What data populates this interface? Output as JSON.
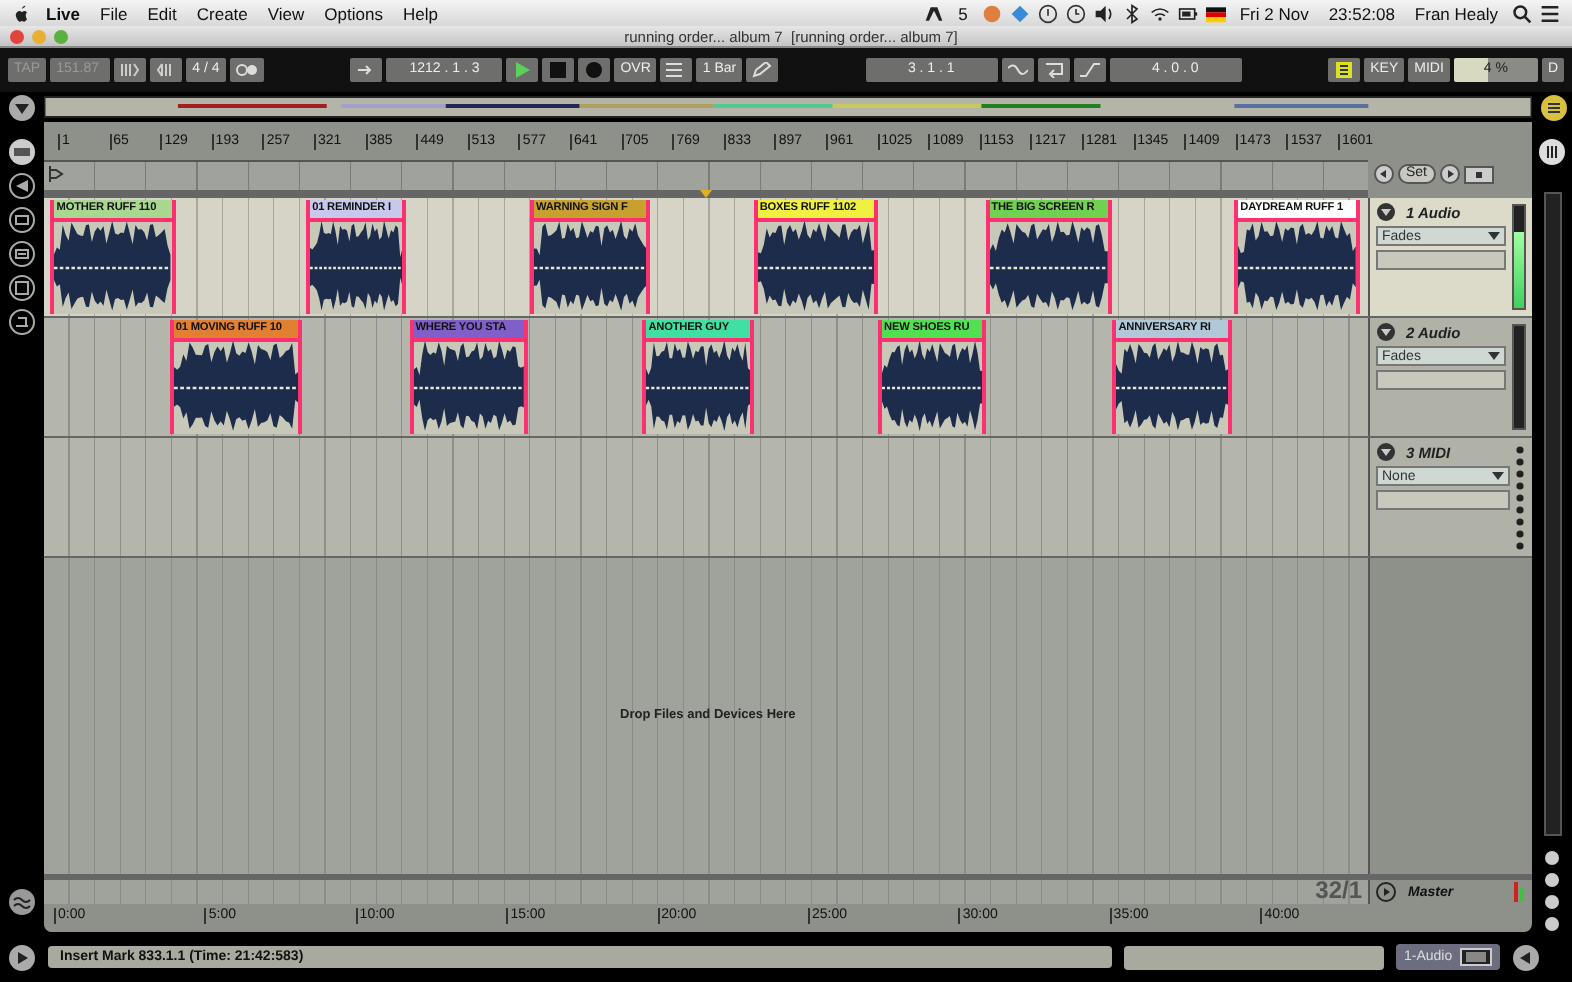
{
  "menu_bar": {
    "app": "Live",
    "items": [
      "File",
      "Edit",
      "Create",
      "View",
      "Options",
      "Help"
    ],
    "status_text": "5",
    "date": "Fri 2 Nov",
    "time": "23:52:08",
    "user": "Fran Healy"
  },
  "window": {
    "title": "running order... album 7  [running order... album 7]"
  },
  "control_bar": {
    "tap": "TAP",
    "tempo": "151.87",
    "signature": "4 / 4",
    "position": "1212 . 1 . 3",
    "ovr": "OVR",
    "quantize": "1 Bar",
    "loop_start": "3 . 1 . 1",
    "loop_length": "4 . 0 . 0",
    "key": "KEY",
    "midi": "MIDI",
    "cpu": "4 %",
    "d": "D"
  },
  "ruler": {
    "bars": [
      "1",
      "65",
      "129",
      "193",
      "257",
      "321",
      "385",
      "449",
      "513",
      "577",
      "641",
      "705",
      "769",
      "833",
      "897",
      "961",
      "1025",
      "1089",
      "1153",
      "1217",
      "1281",
      "1345",
      "1409",
      "1473",
      "1537",
      "1601"
    ]
  },
  "locators": {
    "set": "Set"
  },
  "tracks": [
    {
      "name": "1 Audio",
      "kind": "audio",
      "selected": true,
      "device": "Fades",
      "level": 0.75,
      "clips": [
        {
          "label": "MOTHER RUFF 110",
          "color": "#a8d890"
        },
        {
          "label": "01 REMINDER I",
          "color": "#c8c8ec"
        },
        {
          "label": "WARNING SIGN F",
          "color": "#c8a030"
        },
        {
          "label": "BOXES RUFF 1102",
          "color": "#f0f040"
        },
        {
          "label": "THE BIG SCREEN R",
          "color": "#70d050"
        },
        {
          "label": "DAYDREAM RUFF 1",
          "color": "#ffffff"
        }
      ]
    },
    {
      "name": "2 Audio",
      "kind": "audio",
      "selected": false,
      "device": "Fades",
      "clips": [
        {
          "label": "01 MOVING RUFF 10",
          "color": "#e08030"
        },
        {
          "label": "WHERE YOU STA",
          "color": "#8060c8"
        },
        {
          "label": "ANOTHER GUY",
          "color": "#40e0a0"
        },
        {
          "label": "NEW SHOES RU",
          "color": "#50e050"
        },
        {
          "label": "ANNIVERSARY RI",
          "color": "#b0c8d8"
        }
      ]
    },
    {
      "name": "3 MIDI",
      "kind": "midi",
      "selected": false,
      "device": "None"
    }
  ],
  "drop_hint": "Drop Files and Devices Here",
  "master": {
    "zoom": "32/1",
    "name": "Master"
  },
  "time_ruler": [
    "0:00",
    "5:00",
    "10:00",
    "15:00",
    "20:00",
    "25:00",
    "30:00",
    "35:00",
    "40:00"
  ],
  "status_bar": {
    "message": "Insert Mark 833.1.1 (Time: 21:42:583)",
    "track": "1-Audio"
  }
}
